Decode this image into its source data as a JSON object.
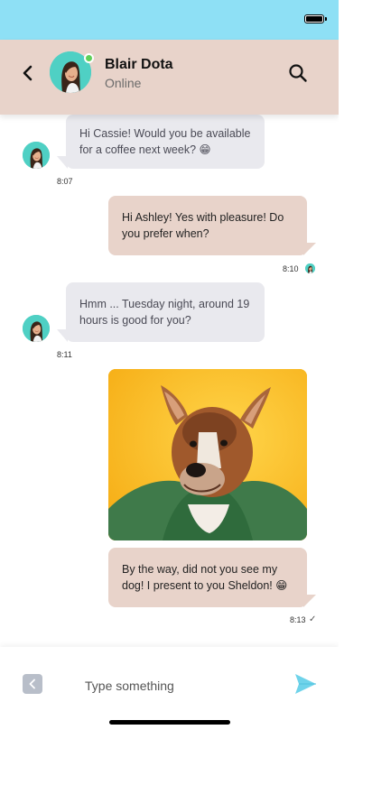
{
  "status_bar": {
    "battery_icon": "battery-icon"
  },
  "header": {
    "contact_name": "Blair Dota",
    "contact_status": "Online",
    "back_icon": "chevron-left-icon",
    "search_icon": "search-icon",
    "online_color": "#5fd05a"
  },
  "messages": [
    {
      "direction": "incoming",
      "text": "Hi Cassie! Would you be available for a coffee next week? 😁",
      "time": "8:07"
    },
    {
      "direction": "outgoing",
      "text": "Hi Ashley! Yes with pleasure! Do you prefer when?",
      "time": "8:10",
      "read_by_avatar": true
    },
    {
      "direction": "incoming",
      "text": "Hmm ... Tuesday night, around 19 hours is good for you?",
      "time": "8:11"
    },
    {
      "direction": "outgoing",
      "type": "image",
      "image_subject": "dog-photo"
    },
    {
      "direction": "outgoing",
      "text": "By the way, did not you see my dog! I present to you Sheldon! 😁",
      "time": "8:13",
      "status": "✓"
    }
  ],
  "composer": {
    "placeholder": "Type something",
    "value": "",
    "attach_icon": "chevron-left-small-icon",
    "send_icon": "send-icon"
  },
  "colors": {
    "status_bar": "#8ee0f5",
    "header": "#e8d3ca",
    "incoming_bubble": "#e9e9ee",
    "outgoing_bubble": "#e8d3ca",
    "send": "#6fd3ea"
  }
}
